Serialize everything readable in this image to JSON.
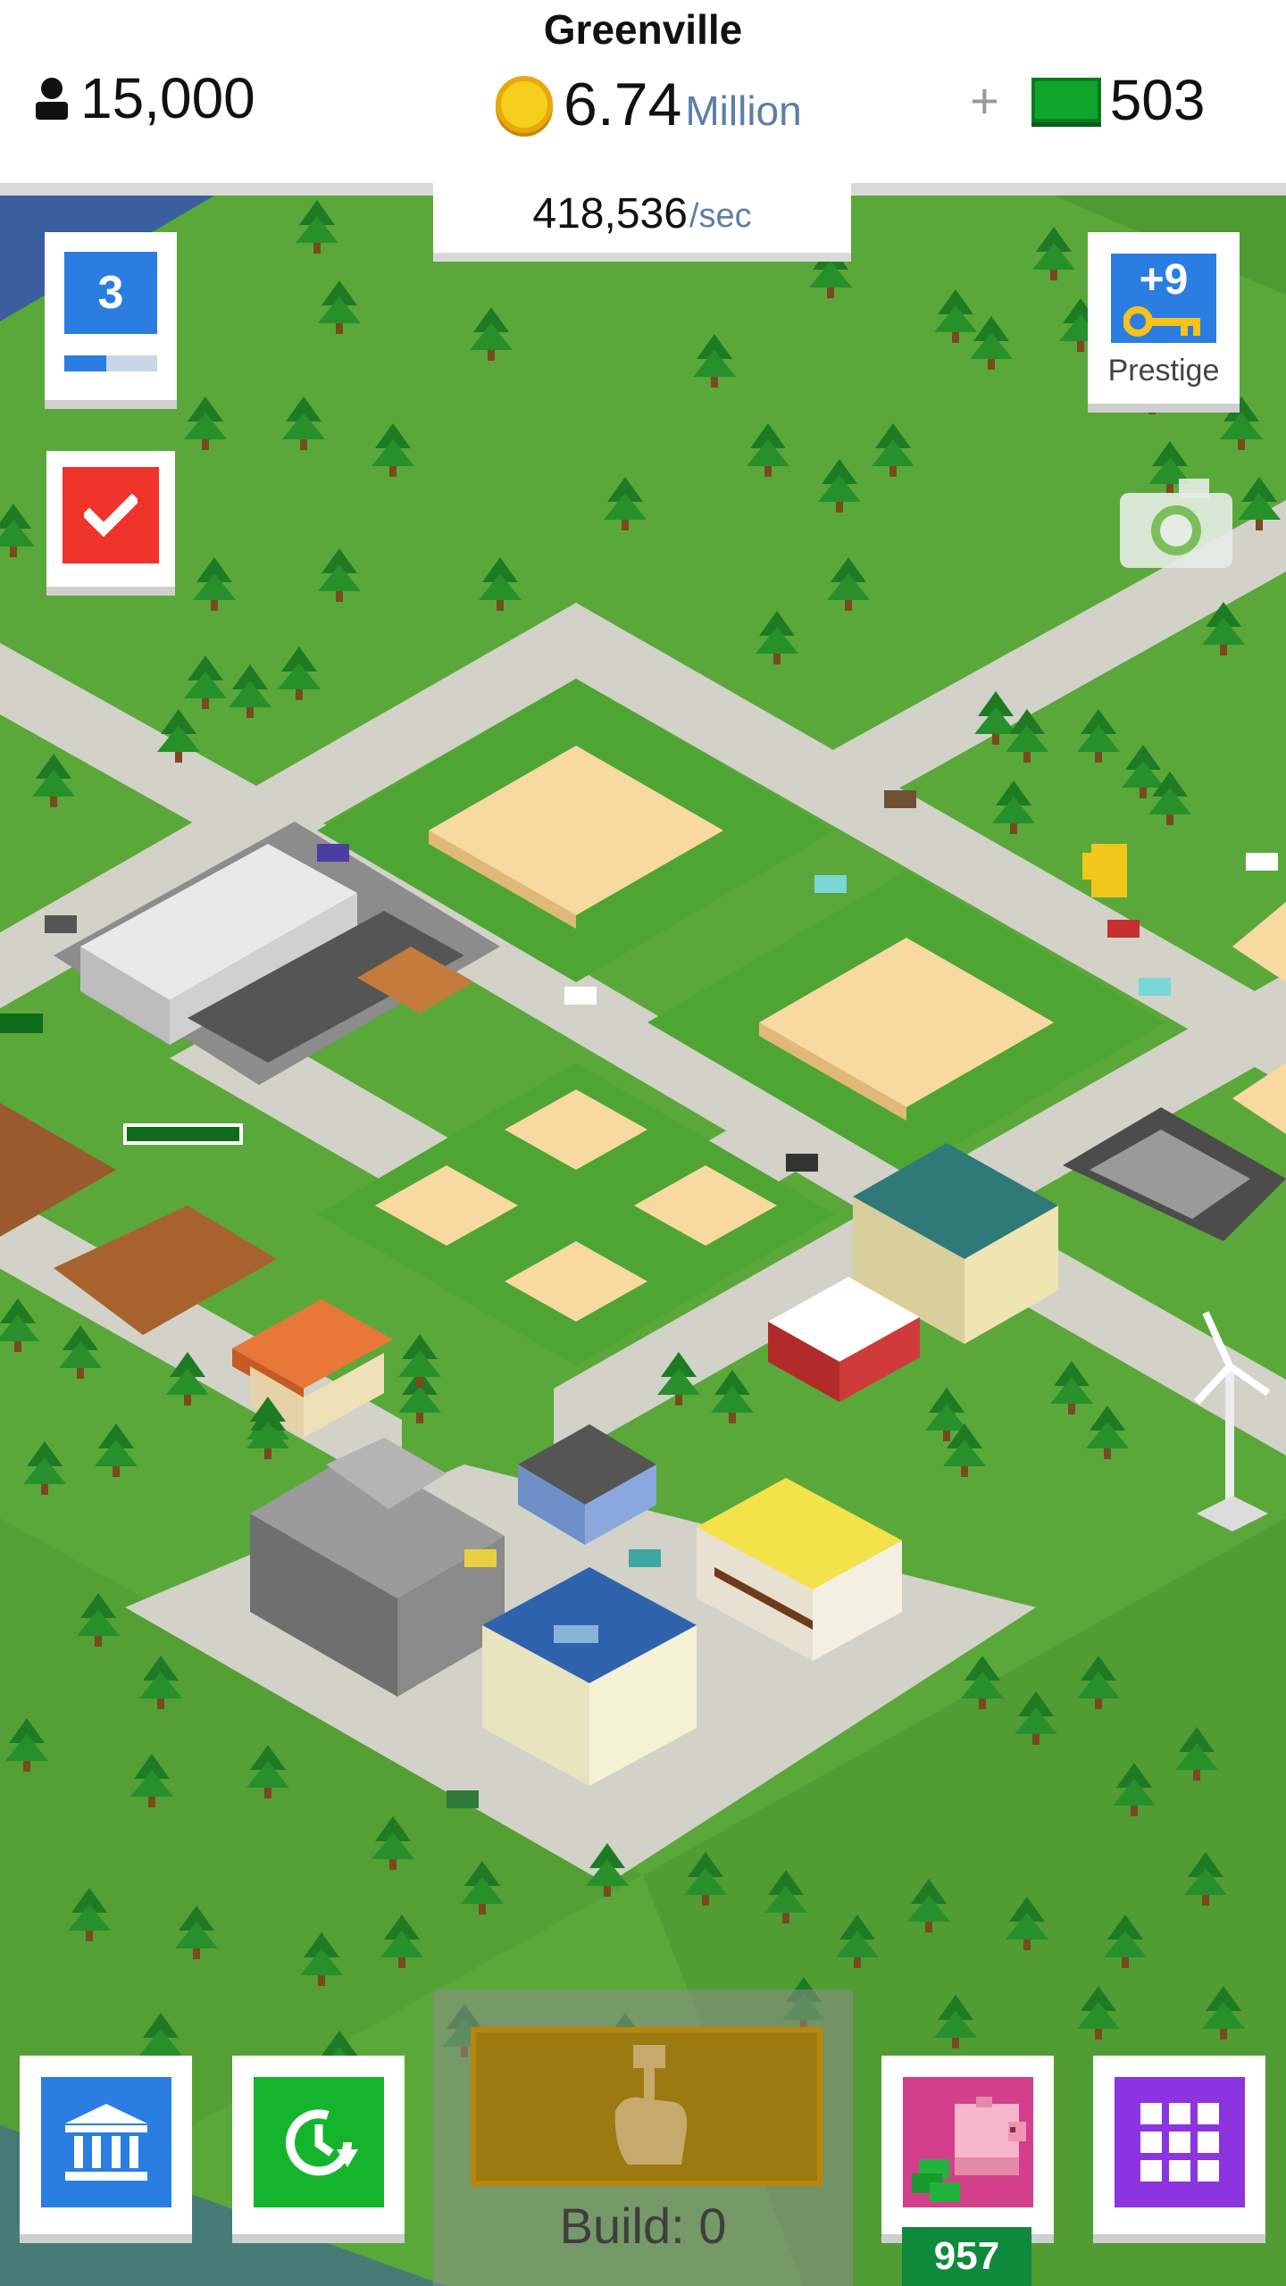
{
  "header": {
    "city_name": "Greenville",
    "population": "15,000",
    "coins": {
      "value": "6.74",
      "unit": "Million"
    },
    "cash": {
      "plus": "+",
      "value": "503"
    },
    "income": {
      "value": "418,536",
      "unit": "/sec"
    }
  },
  "level": {
    "number": "3",
    "progress": 0.45
  },
  "prestige": {
    "bonus": "+9",
    "label": "Prestige"
  },
  "bottom_bar": {
    "build_label": "Build: 0",
    "piggy_bank_count": "957"
  },
  "colors": {
    "grass": "#5aa83a",
    "road": "#d2d2c8",
    "lot": "#f8d9a0",
    "accent_blue": "#2a7de1",
    "accent_red": "#f0332b",
    "accent_green": "#14b52c",
    "accent_purple": "#8b34e0",
    "accent_pink": "#d33f8a",
    "cash_green": "#0fa52a",
    "coin_gold": "#f6cf1d"
  },
  "icons": {
    "population": "person-icon",
    "coins": "gold-coin-icon",
    "cash": "cash-bill-icon",
    "task": "checkmark-icon",
    "prestige": "key-icon",
    "camera": "camera-icon",
    "bank": "bank-icon",
    "boost": "clock-refresh-icon",
    "build": "hammer-hand-icon",
    "piggy": "piggy-bank-icon",
    "apps": "grid-icon"
  }
}
